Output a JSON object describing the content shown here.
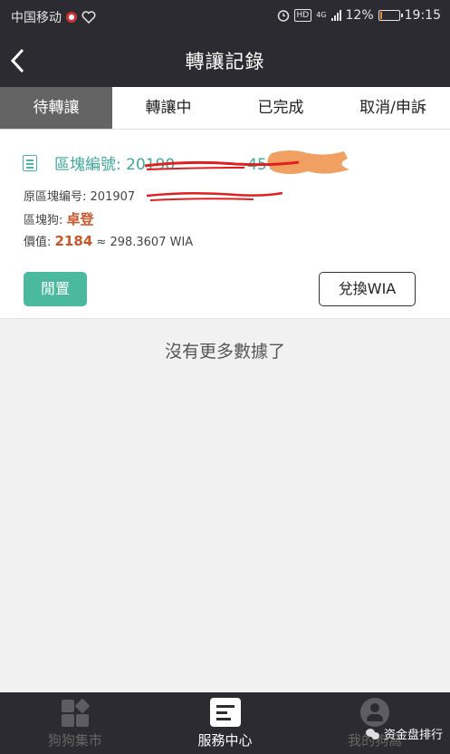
{
  "status_bar": {
    "carrier": "中国移动",
    "signal_label": "4G",
    "battery": "12%",
    "battery_level": 0.12,
    "time": "19:15"
  },
  "header": {
    "title": "轉讓記錄"
  },
  "tabs": [
    {
      "label": "待轉讓",
      "active": true
    },
    {
      "label": "轉讓中",
      "active": false
    },
    {
      "label": "已完成",
      "active": false
    },
    {
      "label": "取消/申訴",
      "active": false
    }
  ],
  "record": {
    "block_label": "區塊編號:",
    "block_number": "20190",
    "block_number_tail": "457",
    "orig_label": "原區塊编号:",
    "orig_number": "201907",
    "dog_label": "區塊狗:",
    "dog_name": "卓登",
    "price_label": "價值:",
    "price_value": "2184",
    "approx_value": "≈ 298.3607 WIA",
    "idle_button": "閒置",
    "exchange_button": "兌換WIA"
  },
  "no_more": "沒有更多數據了",
  "bottom_nav": [
    {
      "label": "狗狗集市",
      "icon": "grid-icon",
      "active": false
    },
    {
      "label": "服務中心",
      "icon": "card-icon",
      "active": true
    },
    {
      "label": "我的狗窩",
      "icon": "user-icon",
      "active": false
    }
  ],
  "watermark": "资金盘排行",
  "colors": {
    "bar": "#2b2b31",
    "accent": "#4bb99e",
    "highlight": "#c9572c",
    "active_tab": "#636363"
  }
}
